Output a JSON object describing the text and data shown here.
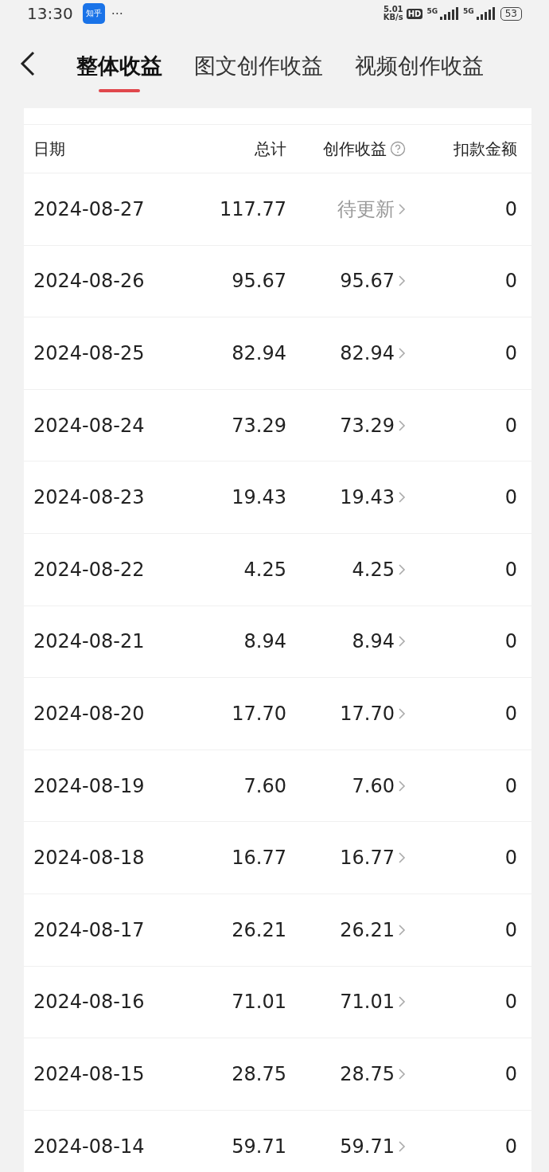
{
  "status_bar": {
    "time": "13:30",
    "app_icon": "知乎",
    "more": "···",
    "net_speed": [
      "5.01",
      "KB/s"
    ],
    "hd": "HD",
    "sim_labels": [
      "5G",
      "5G"
    ],
    "battery": "53"
  },
  "tabs": [
    {
      "label": "整体收益",
      "selected": true
    },
    {
      "label": "图文创作收益",
      "selected": false
    },
    {
      "label": "视频创作收益",
      "selected": false
    }
  ],
  "table": {
    "columns": [
      "日期",
      "总计",
      "创作收益",
      "扣款金额"
    ],
    "rows": [
      {
        "date": "2024-08-27",
        "total": "117.77",
        "creation": "待更新",
        "creation_pending": true,
        "deduction": "0"
      },
      {
        "date": "2024-08-26",
        "total": "95.67",
        "creation": "95.67",
        "creation_pending": false,
        "deduction": "0"
      },
      {
        "date": "2024-08-25",
        "total": "82.94",
        "creation": "82.94",
        "creation_pending": false,
        "deduction": "0"
      },
      {
        "date": "2024-08-24",
        "total": "73.29",
        "creation": "73.29",
        "creation_pending": false,
        "deduction": "0"
      },
      {
        "date": "2024-08-23",
        "total": "19.43",
        "creation": "19.43",
        "creation_pending": false,
        "deduction": "0"
      },
      {
        "date": "2024-08-22",
        "total": "4.25",
        "creation": "4.25",
        "creation_pending": false,
        "deduction": "0"
      },
      {
        "date": "2024-08-21",
        "total": "8.94",
        "creation": "8.94",
        "creation_pending": false,
        "deduction": "0"
      },
      {
        "date": "2024-08-20",
        "total": "17.70",
        "creation": "17.70",
        "creation_pending": false,
        "deduction": "0"
      },
      {
        "date": "2024-08-19",
        "total": "7.60",
        "creation": "7.60",
        "creation_pending": false,
        "deduction": "0"
      },
      {
        "date": "2024-08-18",
        "total": "16.77",
        "creation": "16.77",
        "creation_pending": false,
        "deduction": "0"
      },
      {
        "date": "2024-08-17",
        "total": "26.21",
        "creation": "26.21",
        "creation_pending": false,
        "deduction": "0"
      },
      {
        "date": "2024-08-16",
        "total": "71.01",
        "creation": "71.01",
        "creation_pending": false,
        "deduction": "0"
      },
      {
        "date": "2024-08-15",
        "total": "28.75",
        "creation": "28.75",
        "creation_pending": false,
        "deduction": "0"
      },
      {
        "date": "2024-08-14",
        "total": "59.71",
        "creation": "59.71",
        "creation_pending": false,
        "deduction": "0"
      }
    ]
  }
}
